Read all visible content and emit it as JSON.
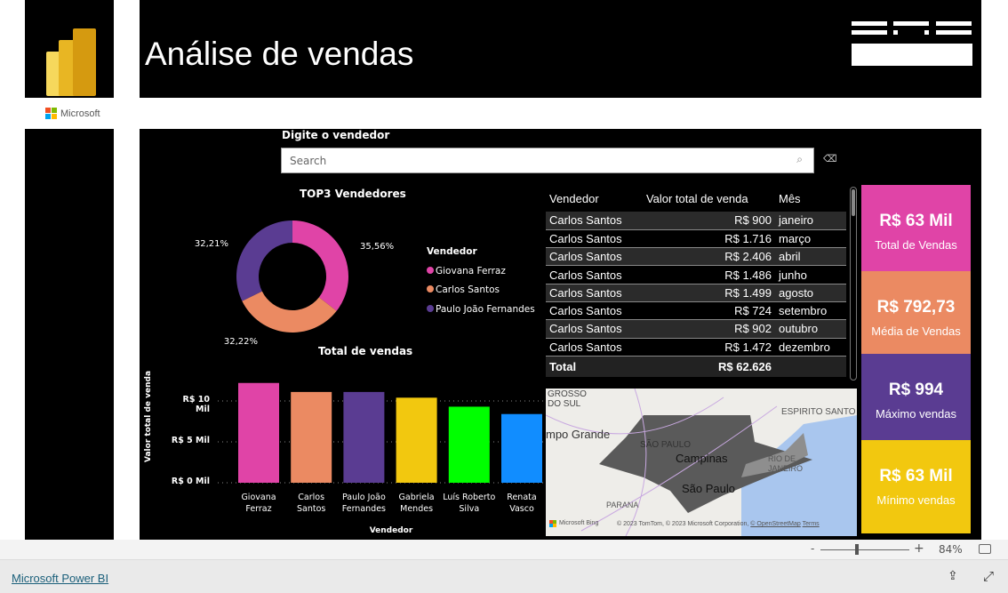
{
  "header": {
    "title": "Análise de vendas",
    "brand_logo": "ENS",
    "microsoft_label": "Microsoft"
  },
  "slicer": {
    "label": "Digite o vendedor",
    "placeholder": "Search"
  },
  "donut": {
    "title": "TOP3 Vendedores",
    "legend_title": "Vendedor",
    "slices": [
      {
        "name": "Giovana Ferraz",
        "pct": 35.56,
        "label": "35,56%",
        "color": "#e044a7"
      },
      {
        "name": "Carlos Santos",
        "pct": 32.22,
        "label": "32,22%",
        "color": "#eb8a62"
      },
      {
        "name": "Paulo João Fernandes",
        "pct": 32.21,
        "label": "32,21%",
        "color": "#5a3c92"
      }
    ]
  },
  "chart_data": {
    "type": "bar",
    "title": "Total de vendas",
    "xlabel": "Vendedor",
    "ylabel": "Valor total de venda",
    "categories": [
      "Giovana Ferraz",
      "Carlos Santos",
      "Paulo João Fernandes",
      "Gabriela Mendes",
      "Luís Roberto Silva",
      "Renata Vasco"
    ],
    "values": [
      12200,
      11100,
      11100,
      10400,
      9300,
      8400
    ],
    "colors": [
      "#e044a7",
      "#eb8a62",
      "#5a3c92",
      "#f2c80f",
      "#00ff00",
      "#118dff"
    ],
    "yticks": [
      {
        "v": 0,
        "label": "R$ 0 Mil"
      },
      {
        "v": 5000,
        "label": "R$ 5 Mil"
      },
      {
        "v": 10000,
        "label": "R$ 10 Mil"
      }
    ],
    "ylim": [
      0,
      13000
    ],
    "grid": true
  },
  "table": {
    "headers": [
      "Vendedor",
      "Valor total de venda",
      "Mês"
    ],
    "rows": [
      [
        "Carlos Santos",
        "R$ 900",
        "janeiro"
      ],
      [
        "Carlos Santos",
        "R$ 1.716",
        "março"
      ],
      [
        "Carlos Santos",
        "R$ 2.406",
        "abril"
      ],
      [
        "Carlos Santos",
        "R$ 1.486",
        "junho"
      ],
      [
        "Carlos Santos",
        "R$ 1.499",
        "agosto"
      ],
      [
        "Carlos Santos",
        "R$ 724",
        "setembro"
      ],
      [
        "Carlos Santos",
        "R$ 902",
        "outubro"
      ],
      [
        "Carlos Santos",
        "R$ 1.472",
        "dezembro"
      ]
    ],
    "total_label": "Total",
    "total_value": "R$ 62.626"
  },
  "map": {
    "labels": [
      "GROSSO DO SUL",
      "mpo Grande",
      "ESPIRITO SANTO",
      "SÃO PAULO",
      "Campinas",
      "RIO DE JANEIRO",
      "São Paulo",
      "PARANA"
    ],
    "bing": "Microsoft Bing",
    "copyright": "© 2023 TomTom, © 2023 Microsoft Corporation,",
    "osm": "© OpenStreetMap",
    "terms": "Terms"
  },
  "kpis": [
    {
      "value": "R$ 63 Mil",
      "label": "Total de Vendas",
      "color": "#e044a7"
    },
    {
      "value": "R$ 792,73",
      "label": "Média de Vendas",
      "color": "#eb8a62"
    },
    {
      "value": "R$ 994",
      "label": "Máximo vendas",
      "color": "#5a3c92"
    },
    {
      "value": "R$ 63 Mil",
      "label": "Mínimo vendas",
      "color": "#f2c80f"
    }
  ],
  "zoom": {
    "minus": "-",
    "plus": "+",
    "level": "84%",
    "value_pct": 84
  },
  "footer": {
    "link": "Microsoft Power BI"
  }
}
